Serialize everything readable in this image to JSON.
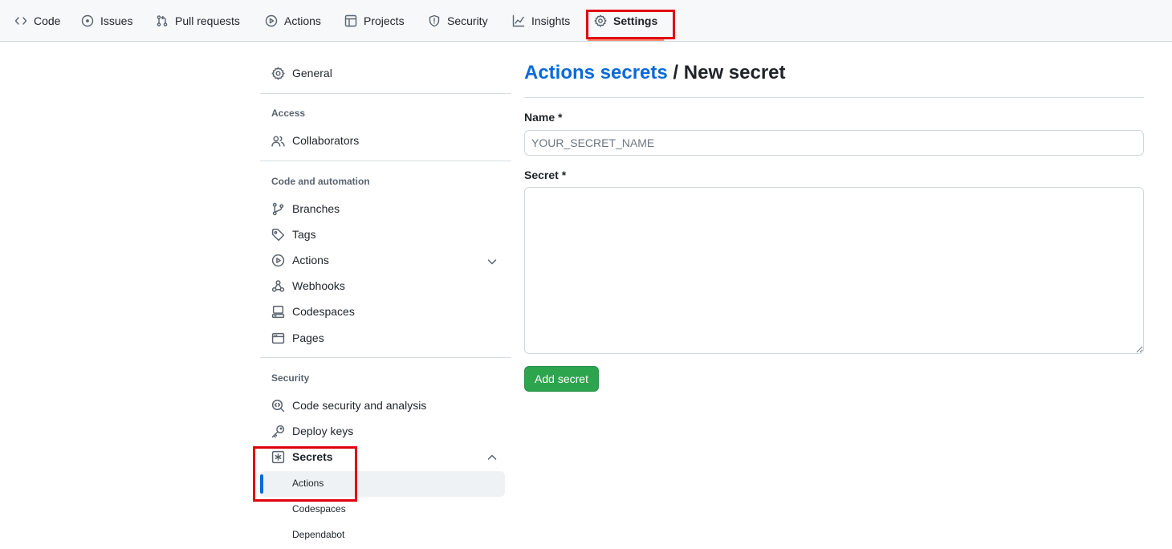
{
  "repo_nav": {
    "tabs": [
      {
        "label": "Code",
        "icon": "code-icon"
      },
      {
        "label": "Issues",
        "icon": "issue-opened-icon"
      },
      {
        "label": "Pull requests",
        "icon": "git-pull-request-icon"
      },
      {
        "label": "Actions",
        "icon": "play-icon"
      },
      {
        "label": "Projects",
        "icon": "table-icon"
      },
      {
        "label": "Security",
        "icon": "shield-icon"
      },
      {
        "label": "Insights",
        "icon": "graph-icon"
      },
      {
        "label": "Settings",
        "icon": "gear-icon",
        "active": true
      }
    ]
  },
  "sidebar": {
    "general": {
      "label": "General",
      "icon": "gear-icon"
    },
    "access": {
      "heading": "Access",
      "items": [
        {
          "label": "Collaborators",
          "icon": "people-icon"
        }
      ]
    },
    "code_and_automation": {
      "heading": "Code and automation",
      "items": [
        {
          "label": "Branches",
          "icon": "git-branch-icon"
        },
        {
          "label": "Tags",
          "icon": "tag-icon"
        },
        {
          "label": "Actions",
          "icon": "play-icon",
          "expandable": true
        },
        {
          "label": "Webhooks",
          "icon": "webhook-icon"
        },
        {
          "label": "Codespaces",
          "icon": "codespaces-icon"
        },
        {
          "label": "Pages",
          "icon": "browser-icon"
        }
      ]
    },
    "security": {
      "heading": "Security",
      "items": [
        {
          "label": "Code security and analysis",
          "icon": "codescan-icon"
        },
        {
          "label": "Deploy keys",
          "icon": "key-icon"
        },
        {
          "label": "Secrets",
          "icon": "key-asterisk-icon",
          "expanded": true,
          "children": [
            {
              "label": "Actions",
              "active": true
            },
            {
              "label": "Codespaces"
            },
            {
              "label": "Dependabot"
            }
          ]
        }
      ]
    }
  },
  "main": {
    "breadcrumb_link": "Actions secrets",
    "breadcrumb_separator": "/",
    "breadcrumb_current": "New secret",
    "name_label": "Name *",
    "name_placeholder": "YOUR_SECRET_NAME",
    "name_value": "",
    "secret_label": "Secret *",
    "secret_value": "",
    "submit_label": "Add secret"
  },
  "colors": {
    "link": "#0969da",
    "primary_button": "#2da44e",
    "highlight_box": "#e1000f",
    "active_tab_underline": "#fd8c73",
    "active_nav_indicator": "#0969da"
  }
}
